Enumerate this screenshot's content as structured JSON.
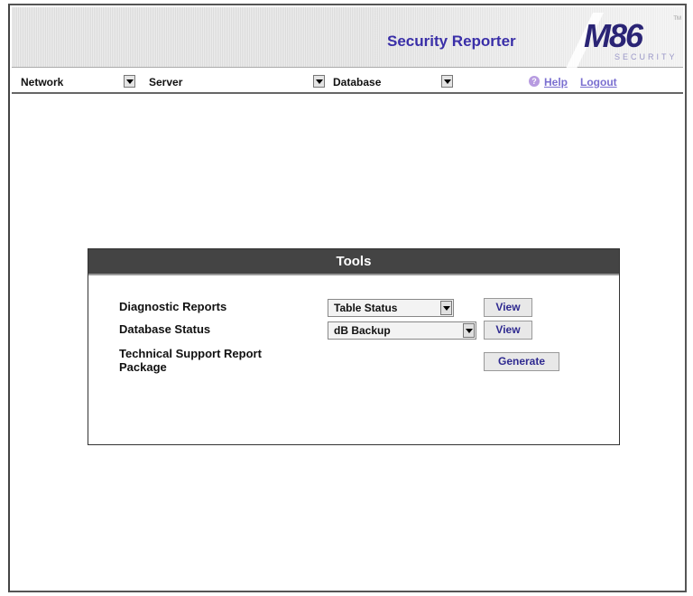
{
  "header": {
    "app_title": "Security Reporter",
    "logo_text": "M86",
    "logo_subtext": "SECURITY",
    "logo_tm": "TM"
  },
  "nav": {
    "items": [
      {
        "label": "Network"
      },
      {
        "label": "Server"
      },
      {
        "label": "Database"
      }
    ],
    "help_label": "Help",
    "logout_label": "Logout"
  },
  "tools": {
    "title": "Tools",
    "rows": [
      {
        "label": "Diagnostic Reports",
        "select_value": "Table Status",
        "button": "View"
      },
      {
        "label": "Database Status",
        "select_value": "dB Backup",
        "button": "View"
      },
      {
        "label": "Technical Support Report Package",
        "button": "Generate"
      }
    ]
  },
  "colors": {
    "title": "#3a2fa8",
    "panel_header": "#444444",
    "link": "#7a6fd0"
  }
}
